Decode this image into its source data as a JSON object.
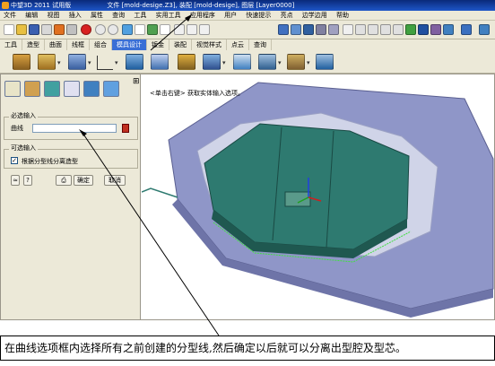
{
  "window": {
    "app_title": "中望3D 2011 试用版",
    "file_label": "文件 [mold-desige.Z3], 装配 [mold-desige], 图层 [Layer0000]"
  },
  "menubar": [
    "文件",
    "编辑",
    "视图",
    "插入",
    "属性",
    "查询",
    "工具",
    "实用工具",
    "应用程序",
    "用户",
    "快速提示",
    "亮点",
    "边学边用",
    "帮助"
  ],
  "tabs": [
    "工具",
    "造型",
    "曲面",
    "线框",
    "组合",
    "模具设计",
    "钣金",
    "装配",
    "视觉样式",
    "点云",
    "查询"
  ],
  "active_tab": "模具设计",
  "panel": {
    "required_section": "必选输入",
    "curve_label": "曲线",
    "curve_value": "",
    "optional_section": "可选输入",
    "checkbox_label": "根据分型线分离造型",
    "checkbox_checked": true,
    "ok_button": "确定",
    "cancel_button": "取消"
  },
  "viewport": {
    "hint": "<单击右键> 获取实体输入选项。"
  },
  "caption": "在曲线选项框内选择所有之前创建的分型线,然后确定以后就可以分离出型腔及型芯。",
  "colors": {
    "sheet": "#8f96c8",
    "part": "#2e7a70",
    "titlebar": "#1e56c8",
    "panel_bg": "#ece9d8"
  },
  "icons": {
    "toolbar_top": [
      "new-icon",
      "open-icon",
      "save-icon",
      "print-icon",
      "brush-icon",
      "cut-icon",
      "stop-icon",
      "undo-icon",
      "redo-icon",
      "rebuild-icon",
      "copy-icon",
      "pointer-icon",
      "snap-icon",
      "view-icon",
      "zoom-icon",
      "shade-icon",
      "cube-icon"
    ],
    "toolbar_mold": [
      "core-block-icon",
      "parting-surface-icon",
      "extrude-icon",
      "axis-icon",
      "split-icon",
      "sheet-icon",
      "cavity-icon",
      "slider-icon",
      "insert-icon",
      "ejector-icon",
      "runner-icon",
      "cooling-icon"
    ],
    "panel_tabs": [
      "history-icon",
      "part-icon",
      "layer-icon",
      "view-icon",
      "display-icon",
      "attribute-icon"
    ]
  }
}
